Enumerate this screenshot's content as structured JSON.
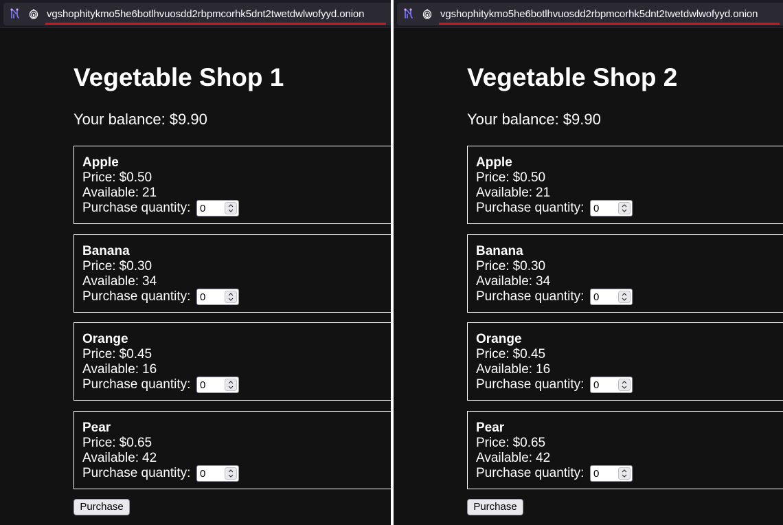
{
  "panes": [
    {
      "url": "vgshophitykmo5he6botlhvuosdd2rbpmcorhk5dnt2twetdwlwofyyd.onion",
      "title": "Vegetable Shop 1",
      "balance_label": "Your balance:",
      "balance_value": "$9.90",
      "items": [
        {
          "name": "Apple",
          "price_label": "Price:",
          "price": "$0.50",
          "avail_label": "Available:",
          "available": "21",
          "qty_label": "Purchase quantity:",
          "quantity": "0"
        },
        {
          "name": "Banana",
          "price_label": "Price:",
          "price": "$0.30",
          "avail_label": "Available:",
          "available": "34",
          "qty_label": "Purchase quantity:",
          "quantity": "0"
        },
        {
          "name": "Orange",
          "price_label": "Price:",
          "price": "$0.45",
          "avail_label": "Available:",
          "available": "16",
          "qty_label": "Purchase quantity:",
          "quantity": "0"
        },
        {
          "name": "Pear",
          "price_label": "Price:",
          "price": "$0.65",
          "avail_label": "Available:",
          "available": "42",
          "qty_label": "Purchase quantity:",
          "quantity": "0"
        }
      ],
      "purchase_label": "Purchase"
    },
    {
      "url": "vgshophitykmo5he6botlhvuosdd2rbpmcorhk5dnt2twetdwlwofyyd.onion",
      "title": "Vegetable Shop 2",
      "balance_label": "Your balance:",
      "balance_value": "$9.90",
      "items": [
        {
          "name": "Apple",
          "price_label": "Price:",
          "price": "$0.50",
          "avail_label": "Available:",
          "available": "21",
          "qty_label": "Purchase quantity:",
          "quantity": "0"
        },
        {
          "name": "Banana",
          "price_label": "Price:",
          "price": "$0.30",
          "avail_label": "Available:",
          "available": "34",
          "qty_label": "Purchase quantity:",
          "quantity": "0"
        },
        {
          "name": "Orange",
          "price_label": "Price:",
          "price": "$0.45",
          "avail_label": "Available:",
          "available": "16",
          "qty_label": "Purchase quantity:",
          "quantity": "0"
        },
        {
          "name": "Pear",
          "price_label": "Price:",
          "price": "$0.65",
          "avail_label": "Available:",
          "available": "42",
          "qty_label": "Purchase quantity:",
          "quantity": "0"
        }
      ],
      "purchase_label": "Purchase"
    }
  ],
  "icons": {
    "site_icon": "onion-circuit-icon",
    "security_icon": "onion-lock-icon",
    "spinner_icon": "spin-updown-icon"
  },
  "colors": {
    "page_bg": "#121212",
    "url_warning_underline": "#d0161b",
    "onion_icon_accent": "#7a6ff0"
  }
}
